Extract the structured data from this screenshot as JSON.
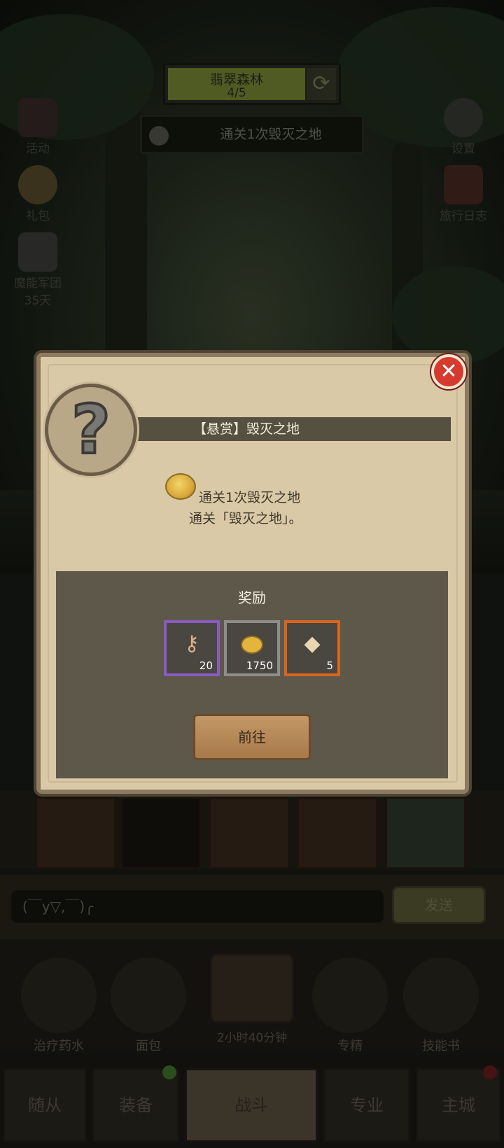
{
  "stage": {
    "name": "翡翠森林",
    "progress": "4/5"
  },
  "quest": {
    "text": "通关1次毁灭之地"
  },
  "left_icons": [
    {
      "label": "活动"
    },
    {
      "label": "礼包"
    },
    {
      "label": "魔能军团",
      "sub": "35天"
    }
  ],
  "right_icons": [
    {
      "label": "设置"
    },
    {
      "label": "旅行日志"
    }
  ],
  "chat": {
    "input": "(￣y▽,￣)╭",
    "send": "发送"
  },
  "consumables": [
    {
      "label": "治疗药水"
    },
    {
      "label": "面包"
    },
    {
      "label": "专精"
    },
    {
      "label": "技能书"
    }
  ],
  "chest_timer": "2小时40分钟",
  "nav": [
    {
      "label": "随从"
    },
    {
      "label": "装备"
    },
    {
      "label": "战斗"
    },
    {
      "label": "专业"
    },
    {
      "label": "主城"
    }
  ],
  "modal": {
    "title": "【悬赏】毁灭之地",
    "desc_line1": "通关1次毁灭之地",
    "desc_line2": "通关「毁灭之地」。",
    "reward_title": "奖励",
    "rewards": [
      {
        "icon": "key-icon",
        "count": "20",
        "border": "#8b5cc0"
      },
      {
        "icon": "coin-icon",
        "count": "1750",
        "border": "#8e8e88"
      },
      {
        "icon": "crate-icon",
        "count": "5",
        "border": "#d9651f"
      }
    ],
    "go_label": "前往"
  }
}
